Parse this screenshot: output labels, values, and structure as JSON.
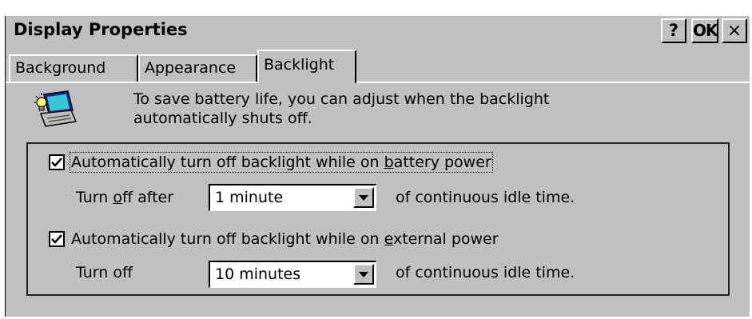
{
  "window": {
    "title": "Display Properties",
    "help_label": "?",
    "ok_label": "OK",
    "close_label": "×"
  },
  "tabs": [
    {
      "label": "Background",
      "active": false
    },
    {
      "label": "Appearance",
      "active": false
    },
    {
      "label": "Backlight",
      "active": true
    }
  ],
  "backlight": {
    "icon": "laptop-backlight-icon",
    "intro_line1": "To save battery life, you can adjust when the backlight",
    "intro_line2": "automatically shuts off.",
    "battery": {
      "checked": true,
      "label_before": "Automatically turn off backlight while on ",
      "label_hotkey": "b",
      "label_after": "attery power",
      "turn_off_before": "Turn ",
      "turn_off_hotkey": "o",
      "turn_off_after": "ff after",
      "selected": "1 minute",
      "suffix": "of continuous idle time."
    },
    "external": {
      "checked": true,
      "label_before": "Automatically turn off backlight while on ",
      "label_hotkey": "e",
      "label_after": "xternal power",
      "turn_off": "Turn off",
      "selected": "10 minutes",
      "suffix": "of continuous idle time."
    }
  }
}
